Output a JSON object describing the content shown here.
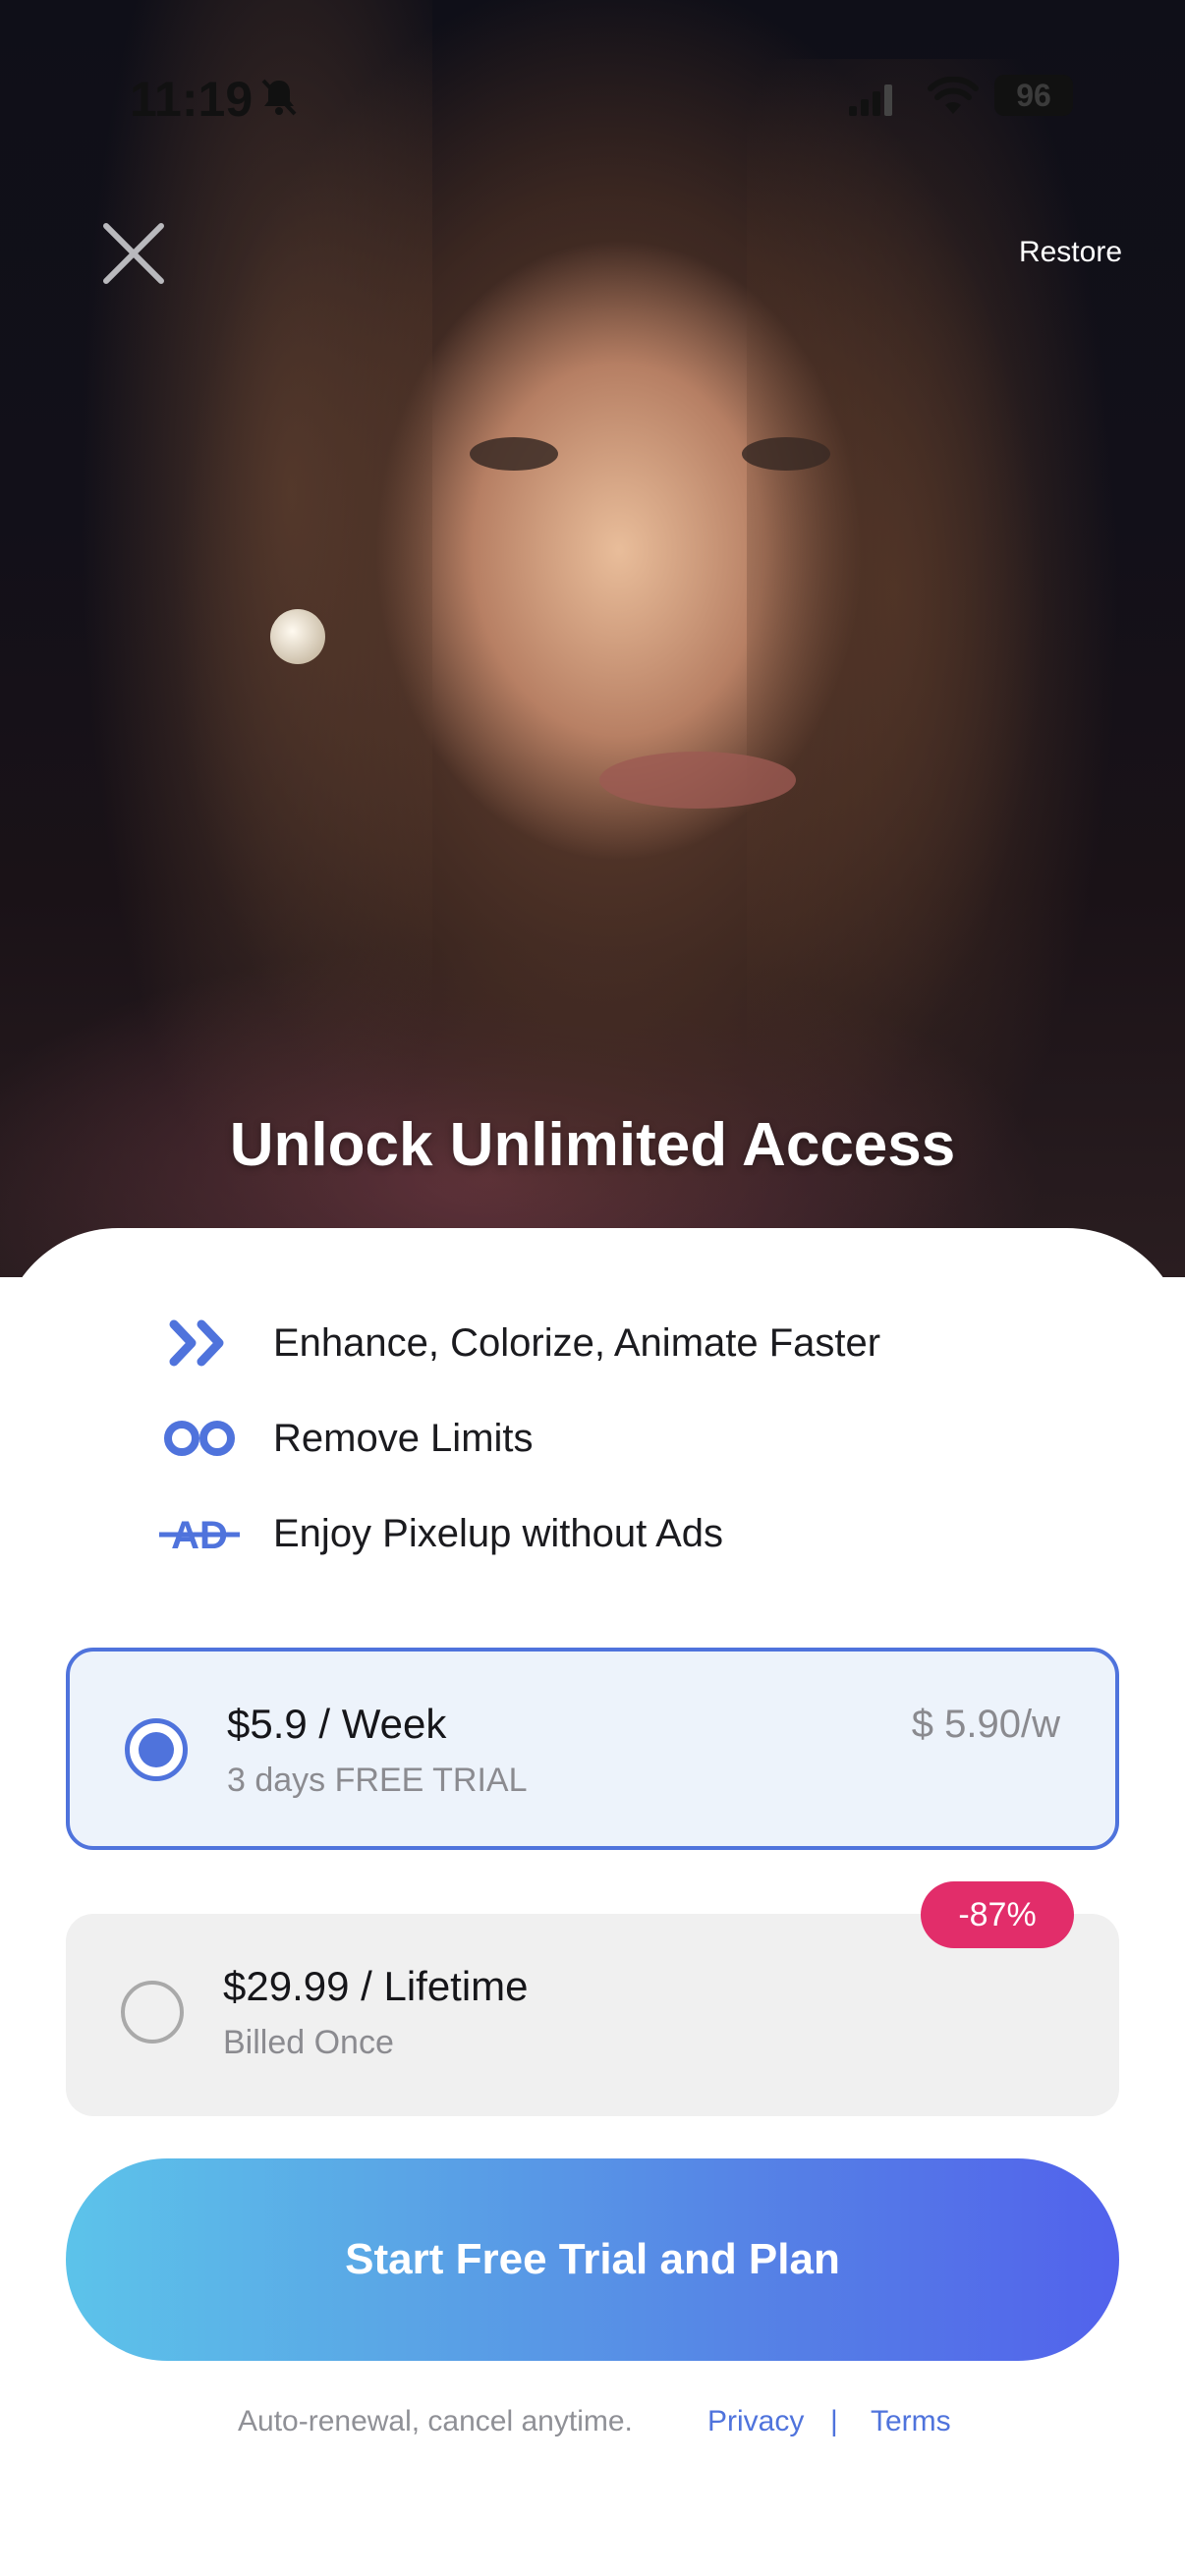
{
  "status_bar": {
    "time": "11:19",
    "battery": "96"
  },
  "header": {
    "restore_label": "Restore",
    "headline": "Unlock Unlimited Access"
  },
  "features": [
    {
      "icon": "double-chevron-right-icon",
      "label": "Enhance, Colorize, Animate Faster"
    },
    {
      "icon": "infinity-icon",
      "label": "Remove Limits"
    },
    {
      "icon": "no-ads-icon",
      "label": "Enjoy Pixelup without Ads",
      "icon_text": "AD"
    }
  ],
  "plans": [
    {
      "title": "$5.9 / Week",
      "subtitle": "3 days FREE TRIAL",
      "price_per": "$ 5.90/w",
      "selected": true
    },
    {
      "title": "$29.99 / Lifetime",
      "subtitle": "Billed Once",
      "badge": "-87%",
      "selected": false
    }
  ],
  "cta": {
    "label": "Start Free Trial and Plan"
  },
  "footer": {
    "note": "Auto-renewal, cancel anytime.",
    "privacy": "Privacy",
    "separator": "|",
    "terms": "Terms"
  },
  "colors": {
    "accent": "#4f73dc",
    "badge": "#e22d6a",
    "cta_start": "#5cc3ea",
    "cta_end": "#5262ec"
  }
}
